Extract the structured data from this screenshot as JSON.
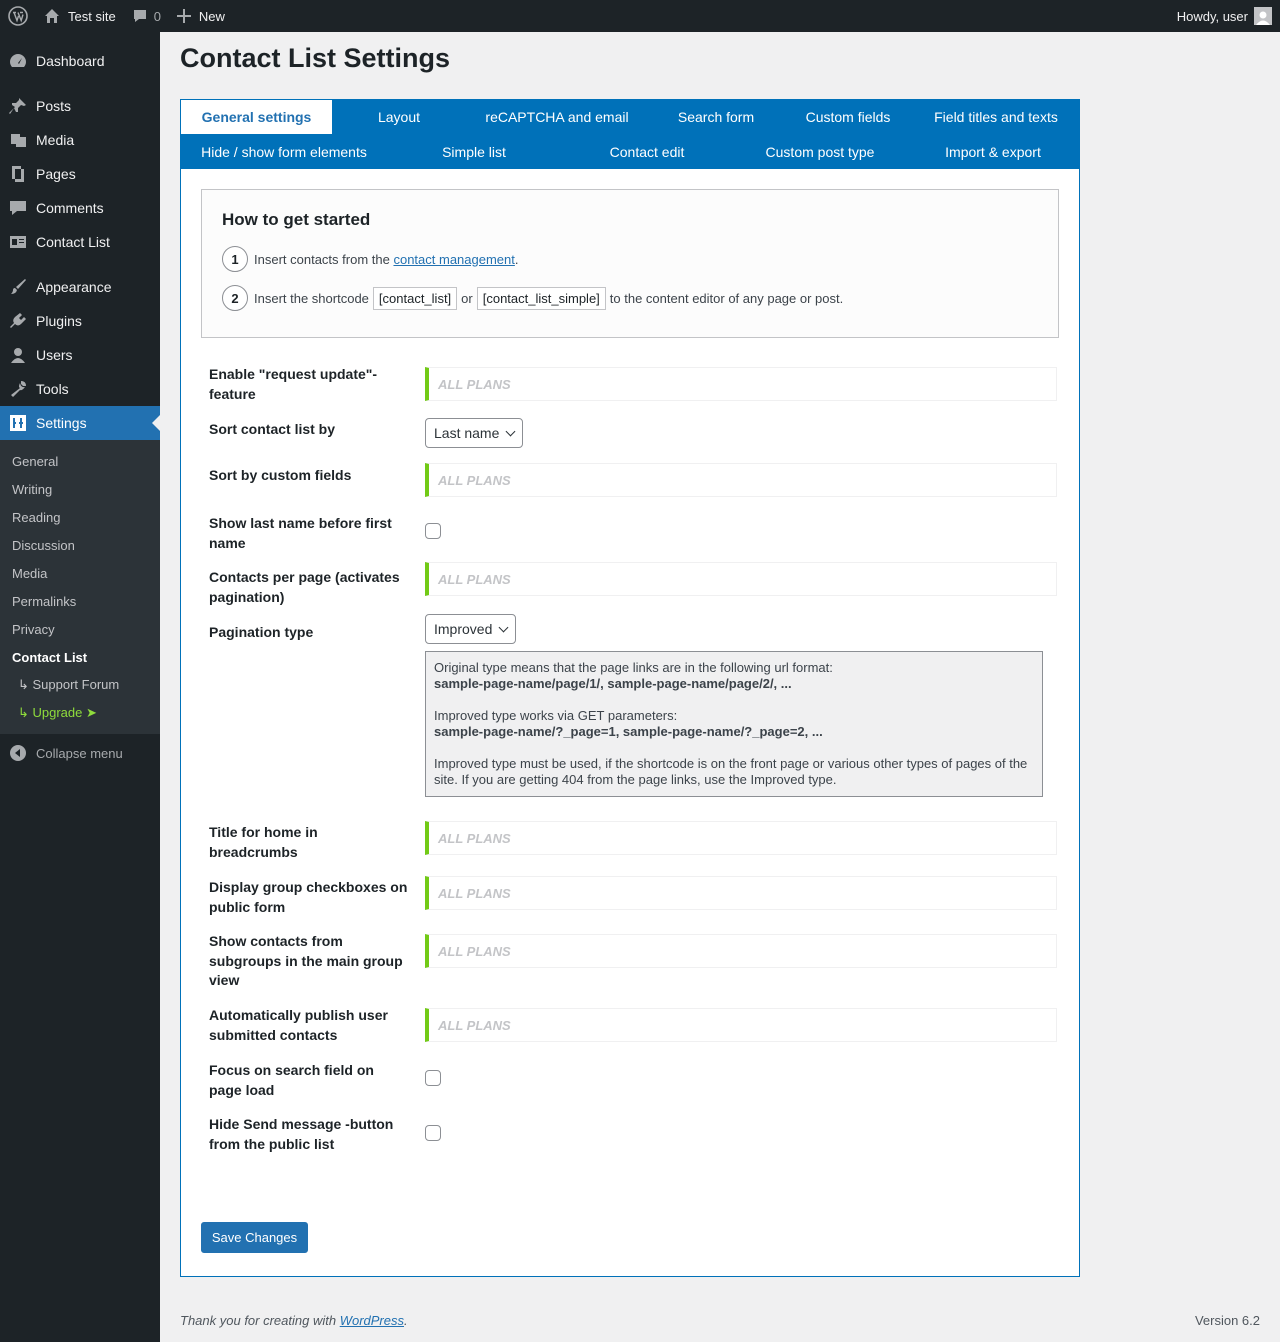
{
  "adminbar": {
    "site_name": "Test site",
    "comments_count": "0",
    "new_label": "New",
    "howdy": "Howdy, user"
  },
  "sidebar": {
    "items": [
      {
        "label": "Dashboard",
        "icon": "dashboard-icon"
      },
      {
        "label": "Posts",
        "icon": "pin-icon"
      },
      {
        "label": "Media",
        "icon": "media-icon"
      },
      {
        "label": "Pages",
        "icon": "pages-icon"
      },
      {
        "label": "Comments",
        "icon": "comment-icon"
      },
      {
        "label": "Contact List",
        "icon": "id-card-icon"
      },
      {
        "label": "Appearance",
        "icon": "brush-icon"
      },
      {
        "label": "Plugins",
        "icon": "plug-icon"
      },
      {
        "label": "Users",
        "icon": "user-icon"
      },
      {
        "label": "Tools",
        "icon": "wrench-icon"
      },
      {
        "label": "Settings",
        "icon": "settings-icon"
      }
    ],
    "submenu": [
      "General",
      "Writing",
      "Reading",
      "Discussion",
      "Media",
      "Permalinks",
      "Privacy",
      "Contact List",
      "↳ Support Forum",
      "↳ Upgrade ➤"
    ],
    "collapse": "Collapse menu"
  },
  "page": {
    "title": "Contact List Settings"
  },
  "tabs": [
    "General settings",
    "Layout",
    "reCAPTCHA and email",
    "Search form",
    "Custom fields",
    "Field titles and texts",
    "Hide / show form elements",
    "Simple list",
    "Contact edit",
    "Custom post type",
    "Import & export"
  ],
  "getting_started": {
    "title": "How to get started",
    "step1_num": "1",
    "step1_text": "Insert contacts from the",
    "step1_link": "contact management",
    "step1_end": ".",
    "step2_num": "2",
    "step2_text": "Insert the shortcode",
    "step2_code1": "[contact_list]",
    "step2_or": "or",
    "step2_code2": "[contact_list_simple]",
    "step2_end": "to the content editor of any page or post."
  },
  "settings": {
    "all_plans": "ALL PLANS",
    "request_update": "Enable \"request update\"-feature",
    "sort_by": "Sort contact list by",
    "sort_by_value": "Last name",
    "sort_custom": "Sort by custom fields",
    "last_first": "Show last name before first name",
    "per_page": "Contacts per page (activates pagination)",
    "pagination_type": "Pagination type",
    "pagination_value": "Improved",
    "info_line1": "Original type means that the page links are in the following url format:",
    "info_line2": "sample-page-name/page/1/, sample-page-name/page/2/, ...",
    "info_line3": "Improved type works via GET parameters:",
    "info_line4": "sample-page-name/?_page=1, sample-page-name/?_page=2, ...",
    "info_line5": "Improved type must be used, if the shortcode is on the front page or various other types of pages of the site. If you are getting 404 from the page links, use the Improved type.",
    "home_breadcrumbs": "Title for home in breadcrumbs",
    "group_checkboxes": "Display group checkboxes on public form",
    "subgroups": "Show contacts from subgroups in the main group view",
    "auto_publish": "Automatically publish user submitted contacts",
    "focus_search": "Focus on search field on page load",
    "hide_send": "Hide Send message -button from the public list"
  },
  "save_label": "Save Changes",
  "footer": {
    "thanks": "Thank you for creating with",
    "link": "WordPress",
    "end": ".",
    "version": "Version 6.2"
  },
  "colors": {
    "accent": "#2271b1",
    "tab_bar": "#0071b9",
    "sidebar": "#1d2327",
    "plan_marker": "#72ca16"
  }
}
